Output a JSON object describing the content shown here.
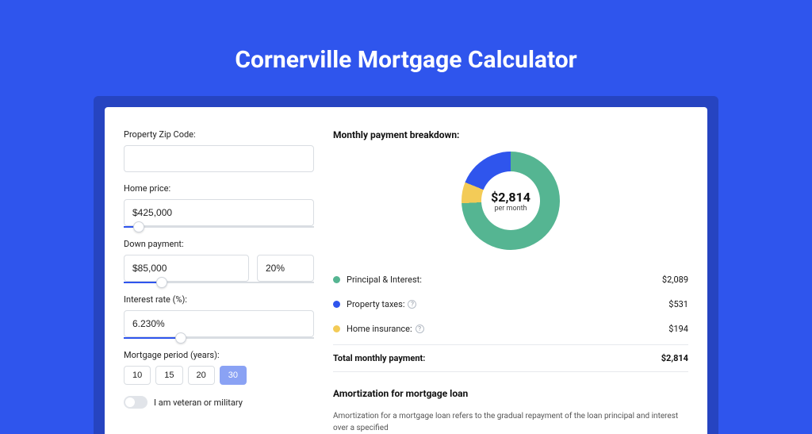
{
  "title": "Cornerville Mortgage Calculator",
  "form": {
    "zip": {
      "label": "Property Zip Code:",
      "value": ""
    },
    "home_price": {
      "label": "Home price:",
      "value": "$425,000",
      "slider_pct": 8
    },
    "down_payment": {
      "label": "Down payment:",
      "amount": "$85,000",
      "percent": "20%",
      "slider_pct": 20
    },
    "interest_rate": {
      "label": "Interest rate (%):",
      "value": "6.230%",
      "slider_pct": 30
    },
    "period": {
      "label": "Mortgage period (years):",
      "options": [
        "10",
        "15",
        "20",
        "30"
      ],
      "selected": "30"
    },
    "veteran": {
      "label": "I am veteran or military",
      "value": false
    }
  },
  "breakdown": {
    "title": "Monthly payment breakdown:",
    "center_amount": "$2,814",
    "center_sub": "per month",
    "items": [
      {
        "label": "Principal & Interest:",
        "value": "$2,089",
        "color": "#55b592",
        "info": false
      },
      {
        "label": "Property taxes:",
        "value": "$531",
        "color": "#2f55ed",
        "info": true
      },
      {
        "label": "Home insurance:",
        "value": "$194",
        "color": "#f3cb57",
        "info": true
      }
    ],
    "total_label": "Total monthly payment:",
    "total_value": "$2,814"
  },
  "amortization": {
    "title": "Amortization for mortgage loan",
    "text": "Amortization for a mortgage loan refers to the gradual repayment of the loan principal and interest over a specified"
  },
  "chart_data": {
    "type": "pie",
    "title": "Monthly payment breakdown",
    "series": [
      {
        "name": "Principal & Interest",
        "value": 2089,
        "color": "#55b592"
      },
      {
        "name": "Property taxes",
        "value": 531,
        "color": "#2f55ed"
      },
      {
        "name": "Home insurance",
        "value": 194,
        "color": "#f3cb57"
      }
    ],
    "total": 2814,
    "center_label": "$2,814 per month"
  }
}
